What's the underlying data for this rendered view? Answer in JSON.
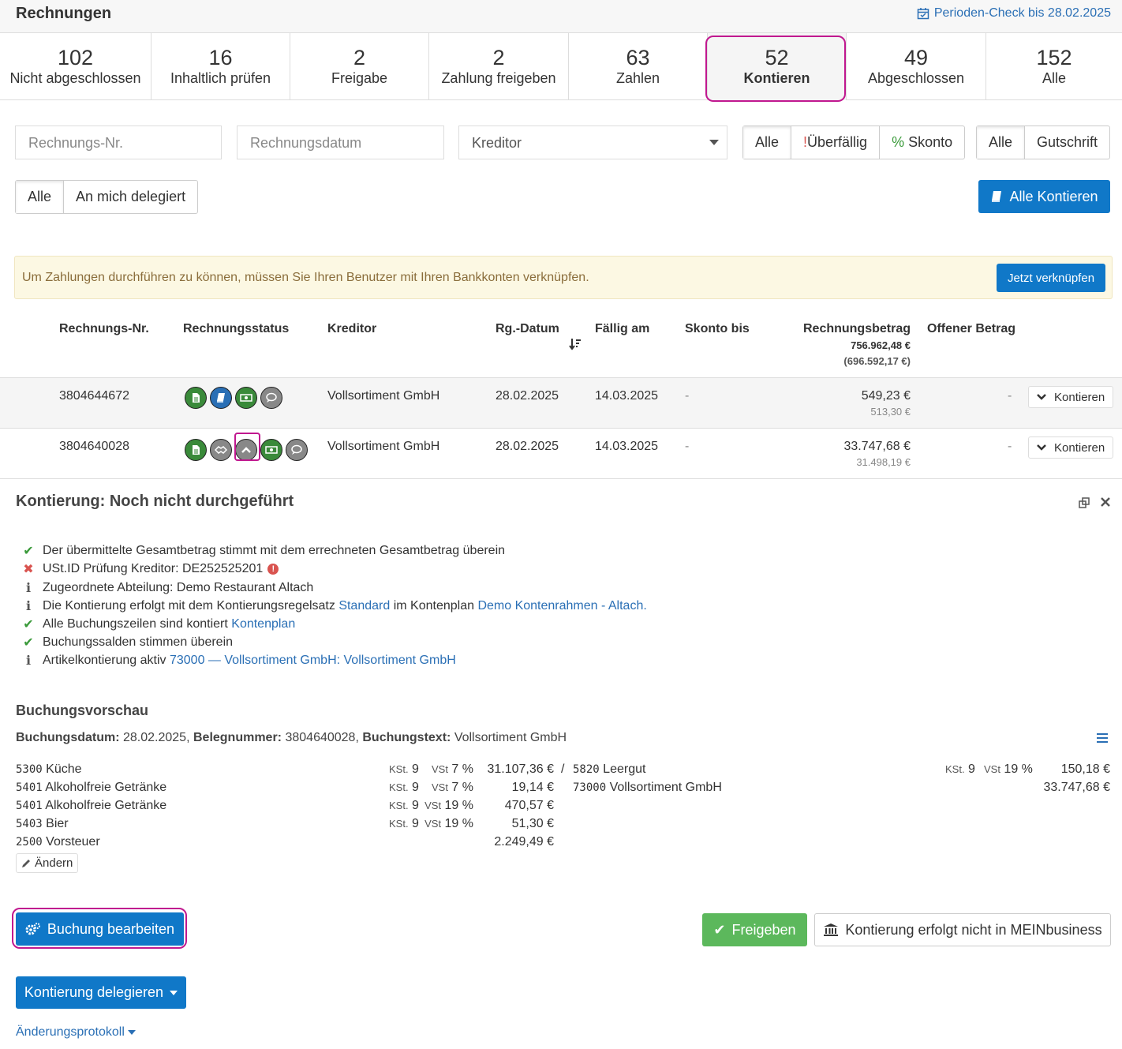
{
  "header": {
    "title": "Rechnungen",
    "period_check": "Perioden-Check bis 28.02.2025"
  },
  "tabs": [
    {
      "count": "102",
      "label": "Nicht abgeschlossen"
    },
    {
      "count": "16",
      "label": "Inhaltlich prüfen"
    },
    {
      "count": "2",
      "label": "Freigabe"
    },
    {
      "count": "2",
      "label": "Zahlung freigeben"
    },
    {
      "count": "63",
      "label": "Zahlen"
    },
    {
      "count": "52",
      "label": "Kontieren"
    },
    {
      "count": "49",
      "label": "Abgeschlossen"
    },
    {
      "count": "152",
      "label": "Alle"
    }
  ],
  "filters": {
    "invoice_no_placeholder": "Rechnungs-Nr.",
    "invoice_date_placeholder": "Rechnungsdatum",
    "creditor_placeholder": "Kreditor",
    "due_group": [
      "Alle",
      "Überfällig",
      "Skonto"
    ],
    "due_prefix": "!",
    "skonto_prefix": "%",
    "type_group": [
      "Alle",
      "Gutschrift"
    ],
    "delegate_group": [
      "Alle",
      "An mich delegiert"
    ],
    "all_kontieren": "Alle Kontieren"
  },
  "alert": {
    "text": "Um Zahlungen durchführen zu können, müssen Sie Ihren Benutzer mit Ihren Bankkonten verknüpfen.",
    "button": "Jetzt verknüpfen"
  },
  "table": {
    "headers": {
      "no": "Rechnungs-Nr.",
      "status": "Rechnungsstatus",
      "creditor": "Kreditor",
      "date": "Rg.-Datum",
      "due": "Fällig am",
      "skonto": "Skonto bis",
      "amount": "Rechnungsbetrag",
      "amount_total": "756.962,48 €",
      "amount_net": "(696.592,17 €)",
      "open": "Offener Betrag"
    },
    "rows": [
      {
        "no": "3804644672",
        "creditor": "Vollsortiment GmbH",
        "date": "28.02.2025",
        "due": "14.03.2025",
        "skonto": "-",
        "amount": "549,23 €",
        "amount_net": "513,30 €",
        "open": "-",
        "action": "Kontieren"
      },
      {
        "no": "3804640028",
        "creditor": "Vollsortiment GmbH",
        "date": "28.02.2025",
        "due": "14.03.2025",
        "skonto": "-",
        "amount": "33.747,68 €",
        "amount_net": "31.498,19 €",
        "open": "-",
        "action": "Kontieren"
      }
    ]
  },
  "detail": {
    "title": "Kontierung: Noch nicht durchgeführt",
    "checks": {
      "c1": "Der übermittelte Gesamtbetrag stimmt mit dem errechneten Gesamtbetrag überein",
      "c2": "USt.ID Prüfung Kreditor: DE252525201",
      "c3": "Zugeordnete Abteilung: Demo Restaurant Altach",
      "c4a": "Die Kontierung erfolgt mit dem Kontierungsregelsatz",
      "c4b": "Standard",
      "c4c": "im Kontenplan",
      "c4d": "Demo Kontenrahmen - Altach.",
      "c5a": "Alle Buchungszeilen sind kontiert",
      "c5b": "Kontenplan",
      "c6": "Buchungssalden stimmen überein",
      "c7a": "Artikelkontierung aktiv",
      "c7b": "73000 — Vollsortiment GmbH: Vollsortiment GmbH"
    },
    "preview_title": "Buchungsvorschau",
    "preview_meta": {
      "date_label": "Buchungsdatum:",
      "date": "28.02.2025,",
      "doc_label": "Belegnummer:",
      "doc": "3804640028,",
      "text_label": "Buchungstext:",
      "text": "Vollsortiment GmbH"
    },
    "debit": [
      {
        "acc": "5300",
        "name": "Küche",
        "kst": "9",
        "vst": "7 %",
        "amount": "31.107,36 €"
      },
      {
        "acc": "5401",
        "name": "Alkoholfreie Getränke",
        "kst": "9",
        "vst": "7 %",
        "amount": "19,14 €"
      },
      {
        "acc": "5401",
        "name": "Alkoholfreie Getränke",
        "kst": "9",
        "vst": "19 %",
        "amount": "470,57 €"
      },
      {
        "acc": "5403",
        "name": "Bier",
        "kst": "9",
        "vst": "19 %",
        "amount": "51,30 €"
      },
      {
        "acc": "2500",
        "name": "Vorsteuer",
        "kst": "",
        "vst": "",
        "amount": "2.249,49 €"
      }
    ],
    "credit": [
      {
        "acc": "5820",
        "name": "Leergut",
        "kst": "9",
        "vst": "19 %",
        "amount": "150,18 €"
      },
      {
        "acc": "73000",
        "name": "Vollsortiment GmbH",
        "kst": "",
        "vst": "",
        "amount": "33.747,68 €"
      }
    ],
    "kst_label": "KSt.",
    "vst_label": "VSt",
    "slash": "/",
    "change": "Ändern",
    "edit_booking": "Buchung bearbeiten",
    "approve": "Freigeben",
    "not_in": "Kontierung erfolgt nicht in MEINbusiness",
    "delegate": "Kontierung delegieren",
    "log": "Änderungsprotokoll"
  }
}
